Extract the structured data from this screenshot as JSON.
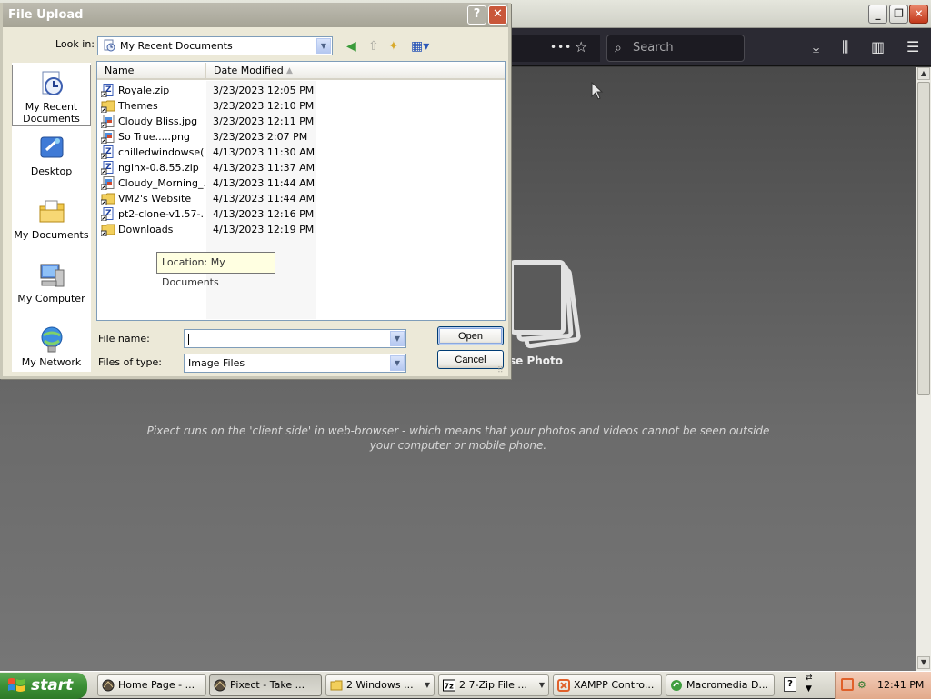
{
  "browser": {
    "search_placeholder": "Search",
    "more_label": "•••",
    "choose_photo": "se Photo",
    "info_line1": "Pixect runs on the 'client side' in web-browser - which means that your photos and videos cannot be seen outside",
    "info_line2": "your computer or mobile phone."
  },
  "dialog": {
    "title": "File Upload",
    "help": "?",
    "close": "✕",
    "lookin_label": "Look in:",
    "lookin_value": "My Recent Documents",
    "places": [
      {
        "label": "My Recent Documents"
      },
      {
        "label": "Desktop"
      },
      {
        "label": "My Documents"
      },
      {
        "label": "My Computer"
      },
      {
        "label": "My Network"
      }
    ],
    "columns": {
      "name": "Name",
      "date": "Date Modified"
    },
    "files": [
      {
        "name": "Royale.zip",
        "date": "3/23/2023 12:05 PM",
        "icon": "zip-shortcut"
      },
      {
        "name": "Themes",
        "date": "3/23/2023 12:10 PM",
        "icon": "folder-shortcut"
      },
      {
        "name": "Cloudy Bliss.jpg",
        "date": "3/23/2023 12:11 PM",
        "icon": "image-shortcut"
      },
      {
        "name": "So True.....png",
        "date": "3/23/2023 2:07 PM",
        "icon": "image-shortcut"
      },
      {
        "name": "chilledwindowse(...",
        "date": "4/13/2023 11:30 AM",
        "icon": "zip-shortcut"
      },
      {
        "name": "nginx-0.8.55.zip",
        "date": "4/13/2023 11:37 AM",
        "icon": "zip-shortcut"
      },
      {
        "name": "Cloudy_Morning_...",
        "date": "4/13/2023 11:44 AM",
        "icon": "image-shortcut"
      },
      {
        "name": "VM2's Website",
        "date": "4/13/2023 11:44 AM",
        "icon": "folder-shortcut"
      },
      {
        "name": "pt2-clone-v1.57-...",
        "date": "4/13/2023 12:16 PM",
        "icon": "zip-shortcut"
      },
      {
        "name": "Downloads",
        "date": "4/13/2023 12:19 PM",
        "icon": "folder-shortcut"
      }
    ],
    "tooltip": "Location: My Documents",
    "filename_label": "File name:",
    "filename_value": "",
    "filetype_label": "Files of type:",
    "filetype_value": "Image Files",
    "open_label": "Open",
    "cancel_label": "Cancel"
  },
  "taskbar": {
    "start_label": "start",
    "tasks": [
      {
        "label": "Home Page - ...",
        "icon": "browser-icon"
      },
      {
        "label": "Pixect - Take ...",
        "icon": "browser-icon"
      },
      {
        "label": "2 Windows ...",
        "icon": "folder-icon"
      },
      {
        "label": "2 7-Zip File ...",
        "icon": "7zip-icon"
      },
      {
        "label": "XAMPP Contro...",
        "icon": "xampp-icon"
      },
      {
        "label": "Macromedia D...",
        "icon": "dreamweaver-icon"
      }
    ],
    "clock": "12:41 PM"
  }
}
